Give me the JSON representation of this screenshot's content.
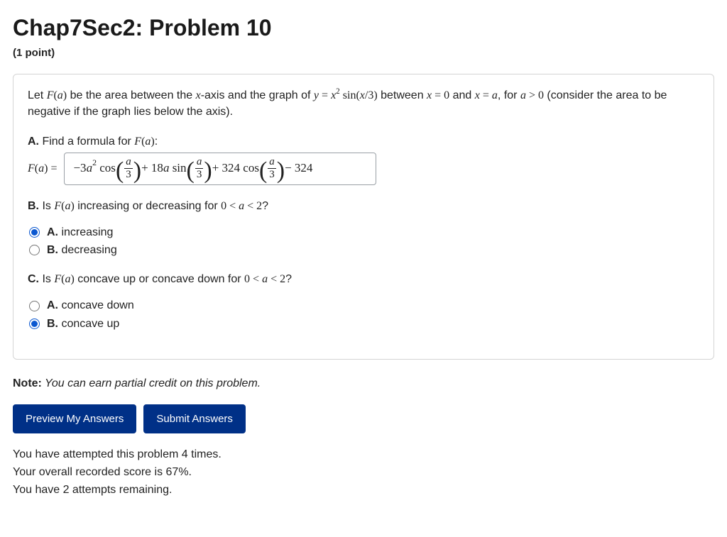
{
  "header": {
    "title": "Chap7Sec2: Problem 10",
    "points": "(1 point)"
  },
  "problem": {
    "intro_pre": "Let ",
    "intro_Fa": "F(a)",
    "intro_mid1": " be the area between the ",
    "intro_x": "x",
    "intro_mid2": "-axis and the graph of ",
    "intro_eq": "y = x² sin(x/3)",
    "intro_mid3": " between ",
    "intro_x0": "x = 0",
    "intro_and": " and ",
    "intro_xa": "x = a",
    "intro_mid4": ", for ",
    "intro_agt0": "a > 0",
    "intro_end": " (consider the area to be negative if the graph lies below the axis).",
    "partA": {
      "label": "A.",
      "text_pre": " Find a formula for ",
      "text_Fa": "F(a)",
      "text_post": ":",
      "lhs": "F(a) = ",
      "answer_plain": "-3a^2 cos(a/3) + 18a sin(a/3) + 324 cos(a/3) - 324"
    },
    "partB": {
      "label": "B.",
      "text_pre": " Is ",
      "text_Fa": "F(a)",
      "text_mid": " increasing or decreasing for ",
      "text_range": "0 < a < 2",
      "text_post": "?",
      "options": [
        {
          "letter": "A.",
          "text": "increasing",
          "selected": true
        },
        {
          "letter": "B.",
          "text": "decreasing",
          "selected": false
        }
      ]
    },
    "partC": {
      "label": "C.",
      "text_pre": " Is ",
      "text_Fa": "F(a)",
      "text_mid": " concave up or concave down for ",
      "text_range": "0 < a < 2",
      "text_post": "?",
      "options": [
        {
          "letter": "A.",
          "text": "concave down",
          "selected": false
        },
        {
          "letter": "B.",
          "text": "concave up",
          "selected": true
        }
      ]
    }
  },
  "note": {
    "label": "Note:",
    "text": " You can earn partial credit on this problem."
  },
  "buttons": {
    "preview": "Preview My Answers",
    "submit": "Submit Answers"
  },
  "status": {
    "attempts": "You have attempted this problem 4 times.",
    "score": "Your overall recorded score is 67%.",
    "remaining": "You have 2 attempts remaining."
  }
}
